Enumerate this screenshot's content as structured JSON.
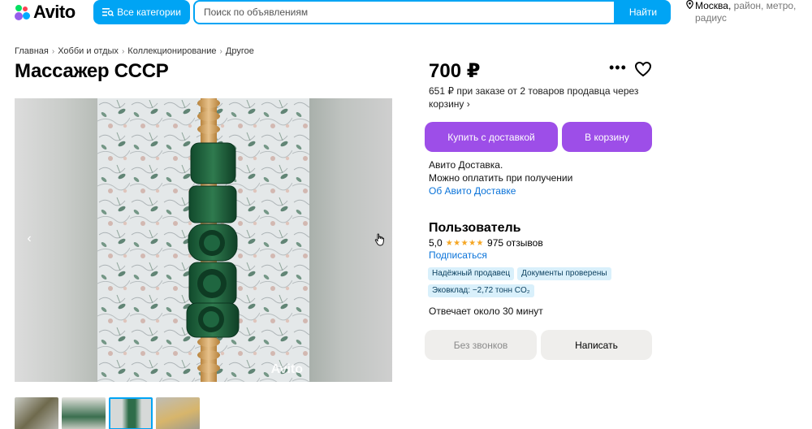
{
  "header": {
    "logo_text": "Avito",
    "categories_label": "Все категории",
    "search_placeholder": "Поиск по объявлениям",
    "search_button": "Найти",
    "location_city": "Москва,",
    "location_hint_1": "район, метро,",
    "location_hint_2": "радиус",
    "colors": {
      "accent": "#00a4f4",
      "purple": "#9d4ee8"
    }
  },
  "breadcrumb": [
    "Главная",
    "Хобби и отдых",
    "Коллекционирование",
    "Другое"
  ],
  "title": "Массажер СССР",
  "gallery": {
    "watermark": "Avito",
    "prev_icon": "chevron-left-icon",
    "next_icon": "chevron-right-icon",
    "thumbnail_count": 4,
    "active_thumbnail": 3
  },
  "offer": {
    "price": "700 ₽",
    "price_note": "651 ₽ при заказе от 2 товаров продавца через корзину ›",
    "buy_button": "Купить с доставкой",
    "cart_button": "В корзину",
    "delivery_line_1": "Авито Доставка.",
    "delivery_line_2": "Можно оплатить при получении",
    "delivery_link": "Об Авито Доставке"
  },
  "seller": {
    "name": "Пользователь",
    "rating": "5,0",
    "stars": "★★★★★",
    "reviews": "975 отзывов",
    "subscribe": "Подписаться",
    "badges": [
      "Надёжный продавец",
      "Документы проверены",
      "Эковклад: −2,72 тонн CO₂"
    ],
    "reply_time": "Отвечает около 30 минут",
    "no_calls_button": "Без звонков",
    "write_button": "Написать"
  }
}
